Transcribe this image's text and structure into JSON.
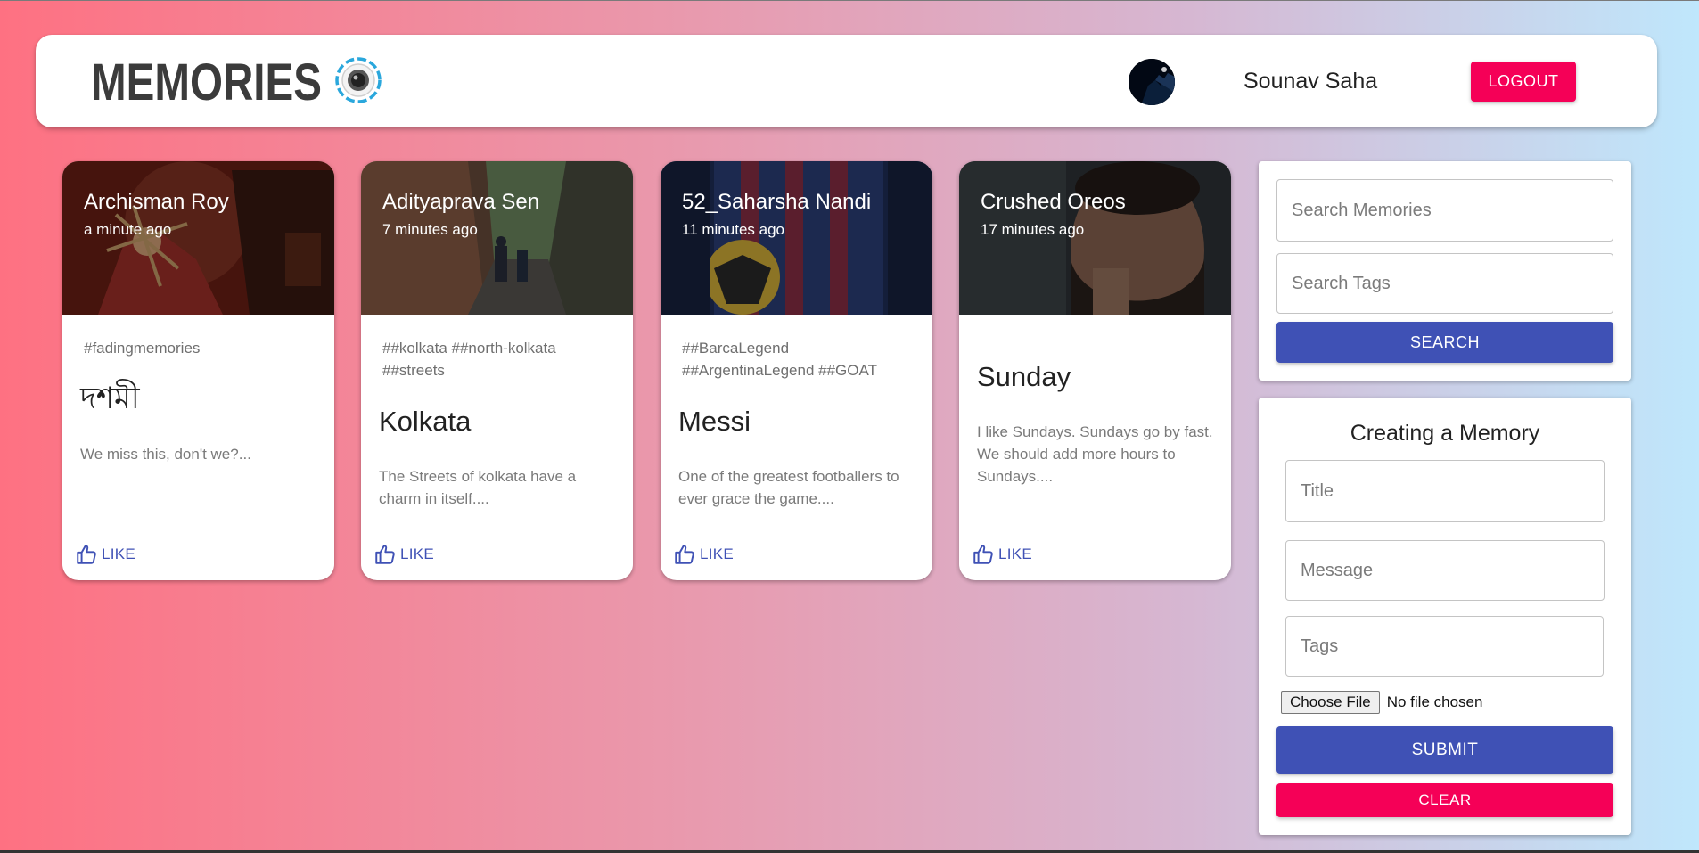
{
  "header": {
    "brand": "MEMORIES",
    "user_name": "Sounav Saha",
    "logout_label": "LOGOUT"
  },
  "posts": [
    {
      "creator": "Archisman Roy",
      "time": "a minute ago",
      "tags": "#fadingmemories",
      "title": "দশমী",
      "message": "We miss this, don't we?...",
      "like_label": "LIKE"
    },
    {
      "creator": "Adityaprava Sen",
      "time": "7 minutes ago",
      "tags": "##kolkata ##north-kolkata ##streets",
      "title": "Kolkata",
      "message": "The Streets of kolkata have a charm in itself....",
      "like_label": "LIKE"
    },
    {
      "creator": "52_Saharsha Nandi",
      "time": "11 minutes ago",
      "tags": "##BarcaLegend ##ArgentinaLegend ##GOAT",
      "title": "Messi",
      "message": "One of the greatest footballers to ever grace the game....",
      "like_label": "LIKE"
    },
    {
      "creator": "Crushed Oreos",
      "time": "17 minutes ago",
      "tags": "",
      "title": "Sunday",
      "message": "I like Sundays. Sundays go by fast. We should add more hours to Sundays....",
      "like_label": "LIKE"
    }
  ],
  "search": {
    "memories_placeholder": "Search Memories",
    "tags_placeholder": "Search Tags",
    "button_label": "SEARCH"
  },
  "form": {
    "heading": "Creating a Memory",
    "title_placeholder": "Title",
    "message_placeholder": "Message",
    "tags_placeholder": "Tags",
    "choose_file_label": "Choose File",
    "no_file_label": "No file chosen",
    "submit_label": "SUBMIT",
    "clear_label": "CLEAR"
  },
  "colors": {
    "primary": "#3f51b5",
    "secondary": "#f50057"
  }
}
